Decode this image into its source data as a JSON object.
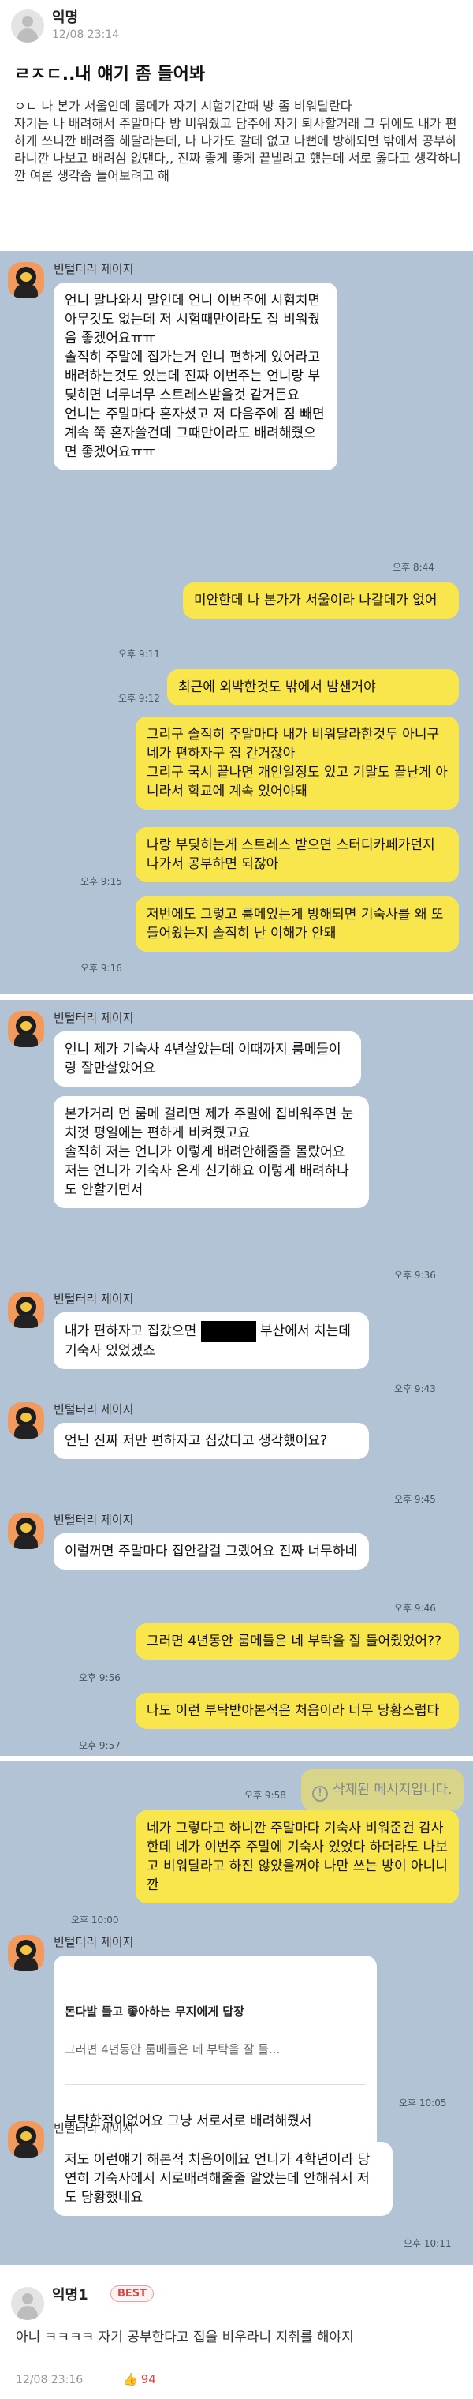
{
  "post": {
    "author": "익명",
    "date": "12/08 23:14",
    "title": "ㄹㅈㄷ..내 얘기 좀 들어봐",
    "body": "ㅇㄴ 나 본가 서울인데 룸메가 자기 시험기간때 방 좀 비워달란다\n자기는 나 배려해서 주말마다 방 비워줬고 담주에 자기 퇴사할거래 그 뒤에도 내가 편하게 쓰니깐 배려좀 해달라는데, 나 나가도 갈데 없고 나뻔에 방해되면 밖에서 공부하라니깐 나보고 배려심 없댄다,, 진짜 좋게 좋게 끝낼려고 했는데 서로 옳다고 생각하니깐 여론 생각좀 들어보려고 해"
  },
  "chat": {
    "partner_name": "빈털터리 제이지",
    "messages": [
      {
        "text": "언니 말나와서 말인데 언니 이번주에 시험치면 아무것도 없는데 저 시험때만이라도 집 비워줬음 좋겠어요ㅠㅠ\n솔직히 주말에 집가는거 언니 편하게 있어라고 배려하는것도 있는데 진짜 이번주는 언니랑 부딪히면 너무너무 스트레스받을것 같거든요\n언니는 주말마다 혼자셨고 저 다음주에 짐 빼면 계속 쭉 혼자쓸건데 그때만이라도 배려해줬으면 좋겠어요ㅠㅠ",
        "time": "오후 8:44"
      },
      {
        "text": "미안한데 나 본가가 서울이라 나갈데가 없어",
        "time": "오후 9:11"
      },
      {
        "text": "최근에 외박한것도 밖에서 밤샌거야",
        "time": "오후 9:12"
      },
      {
        "text": "그리구 솔직히 주말마다 내가 비워달라한것두 아니구 네가 편하자구 집 간거잖아\n그리구 국시 끝나면 개인일정도 있고 기말도 끝난게 아니라서 학교에 계속 있어야돼",
        "time": ""
      },
      {
        "text": "나랑 부딪히는게 스트레스 받으면 스터디카페가던지 나가서 공부하면 되잖아",
        "time": "오후 9:15"
      },
      {
        "text": "저번에도 그렇고 룸메있는게 방해되면 기숙사를 왜 또 들어왔는지 솔직히 난 이해가 안돼",
        "time": "오후 9:16"
      },
      {
        "text": "언니 제가 기숙사 4년살았는데 이때까지 룸메들이랑 잘만살았어요",
        "time": ""
      },
      {
        "text": "본가거리 먼 룸메 걸리면 제가 주말에 집비워주면 눈치껏 평일에는 편하게 비켜줬고요\n솔직히 저는 언니가 이렇게 배려안해줄줄 몰랐어요\n저는 언니가 기숙사 온게 신기해요 이렇게 배려하나도 안할거면서",
        "time": "오후 9:36"
      },
      {
        "text_before": "내가 편하자고 집갔으면",
        "text_after": "부산에서 치는데 기숙사 있었겠죠",
        "time": "오후 9:43"
      },
      {
        "text": "언닌 진짜 저만 편하자고 집갔다고 생각했어요?",
        "time": "오후 9:45"
      },
      {
        "text": "이럴꺼면 주말마다 집안갈걸 그랬어요 진짜 너무하네",
        "time": "오후 9:46"
      },
      {
        "text": "그러면 4년동안 룸메들은 네 부탁을 잘 들어줬었어??",
        "time": "오후 9:56"
      },
      {
        "text": "나도 이런 부탁받아본적은 처음이라 너무 당황스럽다",
        "time": "오후 9:57"
      },
      {
        "text": "삭제된 메시지입니다.",
        "time": "오후 9:58"
      },
      {
        "text": "네가 그렇다고 하니깐 주말마다 기숙사 비워준건 감사한데 네가 이번주 주말에 기숙사 있었다 하더라도 나보고 비워달라고 하진 않았을꺼야 나만 쓰는 방이 아니니깐",
        "time": "오후 10:00"
      },
      {
        "reply_title": "돈다발 들고 좋아하는 무지에게 답장",
        "reply_quote": "그러면 4년동안 룸메들은 네 부탁을 잘 들...",
        "text": "부탁한적이없어요 그냥 서로서로 배려해줬서",
        "time": "오후 10:05"
      },
      {
        "text": "저도 이런얘기 해본적 처음이에요 언니가 4학년이라 당연히 기숙사에서 서로배려해줄줄 알았는데 안해줘서 저도 당황했네요",
        "time": "오후 10:11"
      }
    ]
  },
  "comment": {
    "author": "익명1",
    "badge": "BEST",
    "body": "아니 ㅋㅋㅋㅋ 자기 공부한다고 집을 비우라니 지취를 해야지",
    "date": "12/08 23:16",
    "likes": "94"
  }
}
